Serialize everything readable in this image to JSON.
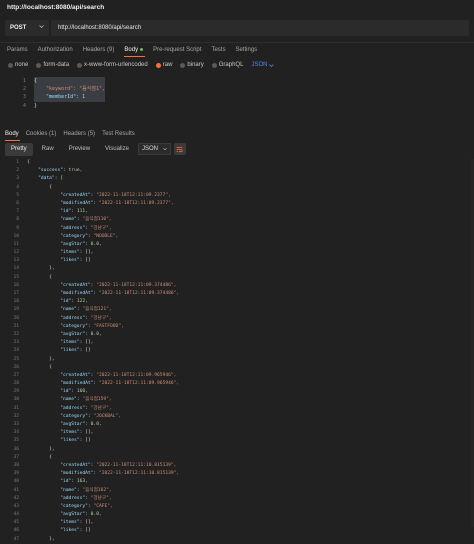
{
  "window": {
    "title": "http://localhost:8080/api/search"
  },
  "request": {
    "method": "POST",
    "url": "http://localhost:8080/api/search"
  },
  "request_tabs": [
    "Params",
    "Authorization",
    "Headers (9)",
    "Body",
    "Pre-request Script",
    "Tests",
    "Settings"
  ],
  "body_options": {
    "items": [
      "none",
      "form-data",
      "x-www-form-urlencoded",
      "raw",
      "binary",
      "GraphQL"
    ],
    "selected": "raw",
    "format": "JSON"
  },
  "request_body": {
    "line_numbers": [
      "1",
      "2",
      "3",
      "4"
    ],
    "lines": [
      "{",
      "    \"keyword\": \"음식점1\",",
      "    \"memberId\": 1",
      "}"
    ]
  },
  "response_tabs": [
    "Body",
    "Cookies (1)",
    "Headers (5)",
    "Test Results"
  ],
  "response_toolbar": {
    "views": [
      "Pretty",
      "Raw",
      "Preview",
      "Visualize"
    ],
    "active_view": "Pretty",
    "format": "JSON"
  },
  "response_body": {
    "lines": [
      "{",
      "    \"success\": true,",
      "    \"data\": [",
      "        {",
      "            \"createdAt\": \"2022-11-18T12:11:09.2377\",",
      "            \"modifiedAt\": \"2022-11-18T12:11:09.2377\",",
      "            \"id\": 111,",
      "            \"name\": \"음식점110\",",
      "            \"address\": \"강남구\",",
      "            \"category\": \"NOODLE\",",
      "            \"avgStar\": 0.0,",
      "            \"items\": [],",
      "            \"likes\": []",
      "        },",
      "        {",
      "            \"createdAt\": \"2022-11-18T12:11:09.374486\",",
      "            \"modifiedAt\": \"2022-11-18T12:11:09.374486\",",
      "            \"id\": 122,",
      "            \"name\": \"음식점121\",",
      "            \"address\": \"강남구\",",
      "            \"category\": \"FASTFOOD\",",
      "            \"avgStar\": 0.0,",
      "            \"items\": [],",
      "            \"likes\": []",
      "        },",
      "        {",
      "            \"createdAt\": \"2022-11-18T12:11:09.965946\",",
      "            \"modifiedAt\": \"2022-11-18T12:11:09.965946\",",
      "            \"id\": 160,",
      "            \"name\": \"음식점159\",",
      "            \"address\": \"강남구\",",
      "            \"category\": \"JOCKBAL\",",
      "            \"avgStar\": 0.0,",
      "            \"items\": [],",
      "            \"likes\": []",
      "        },",
      "        {",
      "            \"createdAt\": \"2022-11-18T12:11:10.815139\",",
      "            \"modifiedAt\": \"2022-11-18T12:11:10.815139\",",
      "            \"id\": 163,",
      "            \"name\": \"음식점162\",",
      "            \"address\": \"강남구\",",
      "            \"category\": \"CAFE\",",
      "            \"avgStar\": 0.0,",
      "            \"items\": [],",
      "            \"likes\": []",
      "        },"
    ]
  },
  "colors": {
    "accent": "#ff6c37",
    "link": "#4a90e2",
    "status_dot": "#6ebd5b"
  }
}
